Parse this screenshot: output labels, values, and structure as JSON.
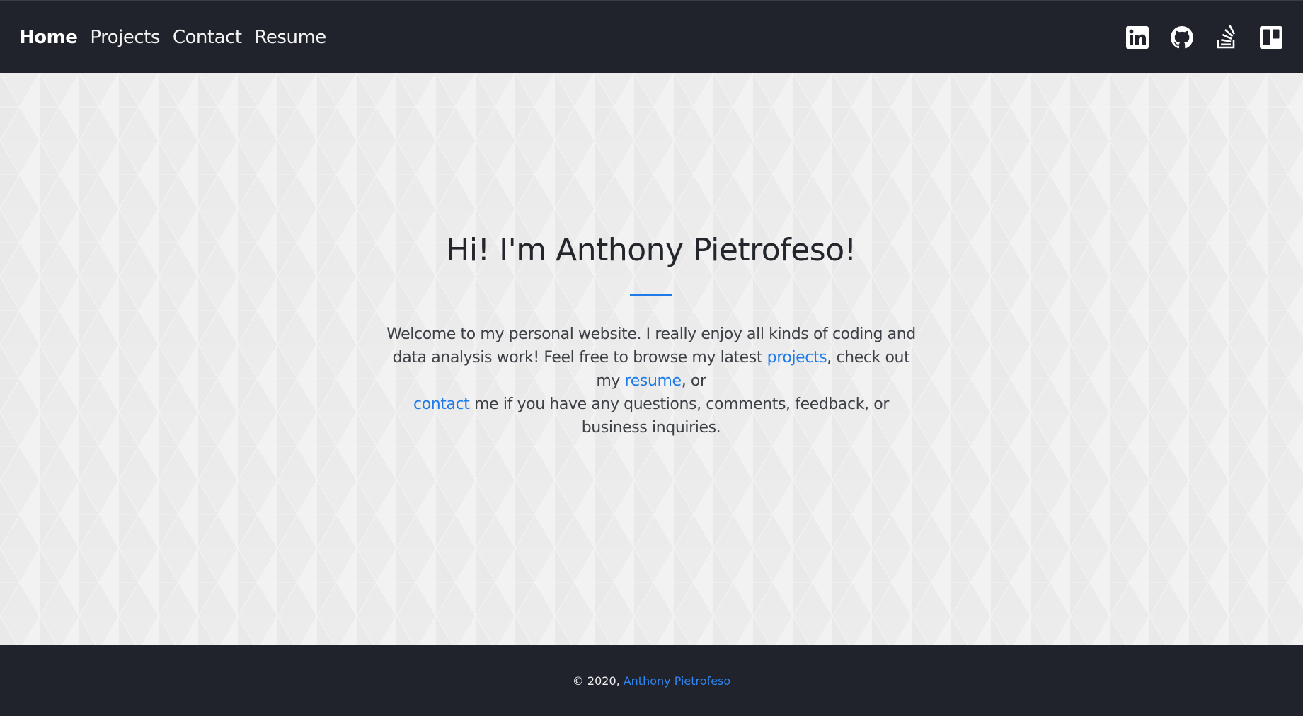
{
  "nav": {
    "links": [
      {
        "label": "Home",
        "active": true
      },
      {
        "label": "Projects",
        "active": false
      },
      {
        "label": "Contact",
        "active": false
      },
      {
        "label": "Resume",
        "active": false
      }
    ],
    "social_icons": [
      "linkedin-icon",
      "github-icon",
      "stackoverflow-icon",
      "trello-icon"
    ]
  },
  "hero": {
    "title": "Hi! I'm Anthony Pietrofeso!",
    "intro_part1": "Welcome to my personal website. I really enjoy all kinds of coding and data analysis work! Feel free to browse my latest ",
    "link_projects": "projects",
    "intro_part2": ", check out my ",
    "link_resume": "resume",
    "intro_part3": ", or ",
    "link_contact": "contact",
    "intro_part4": " me if you have any questions, comments, feedback, or business inquiries."
  },
  "footer": {
    "copyright": "© 2020,",
    "author_link": "Anthony Pietrofeso"
  },
  "colors": {
    "navbar_bg": "#20232c",
    "accent": "#1e7be8",
    "page_bg": "#eeeeee"
  }
}
